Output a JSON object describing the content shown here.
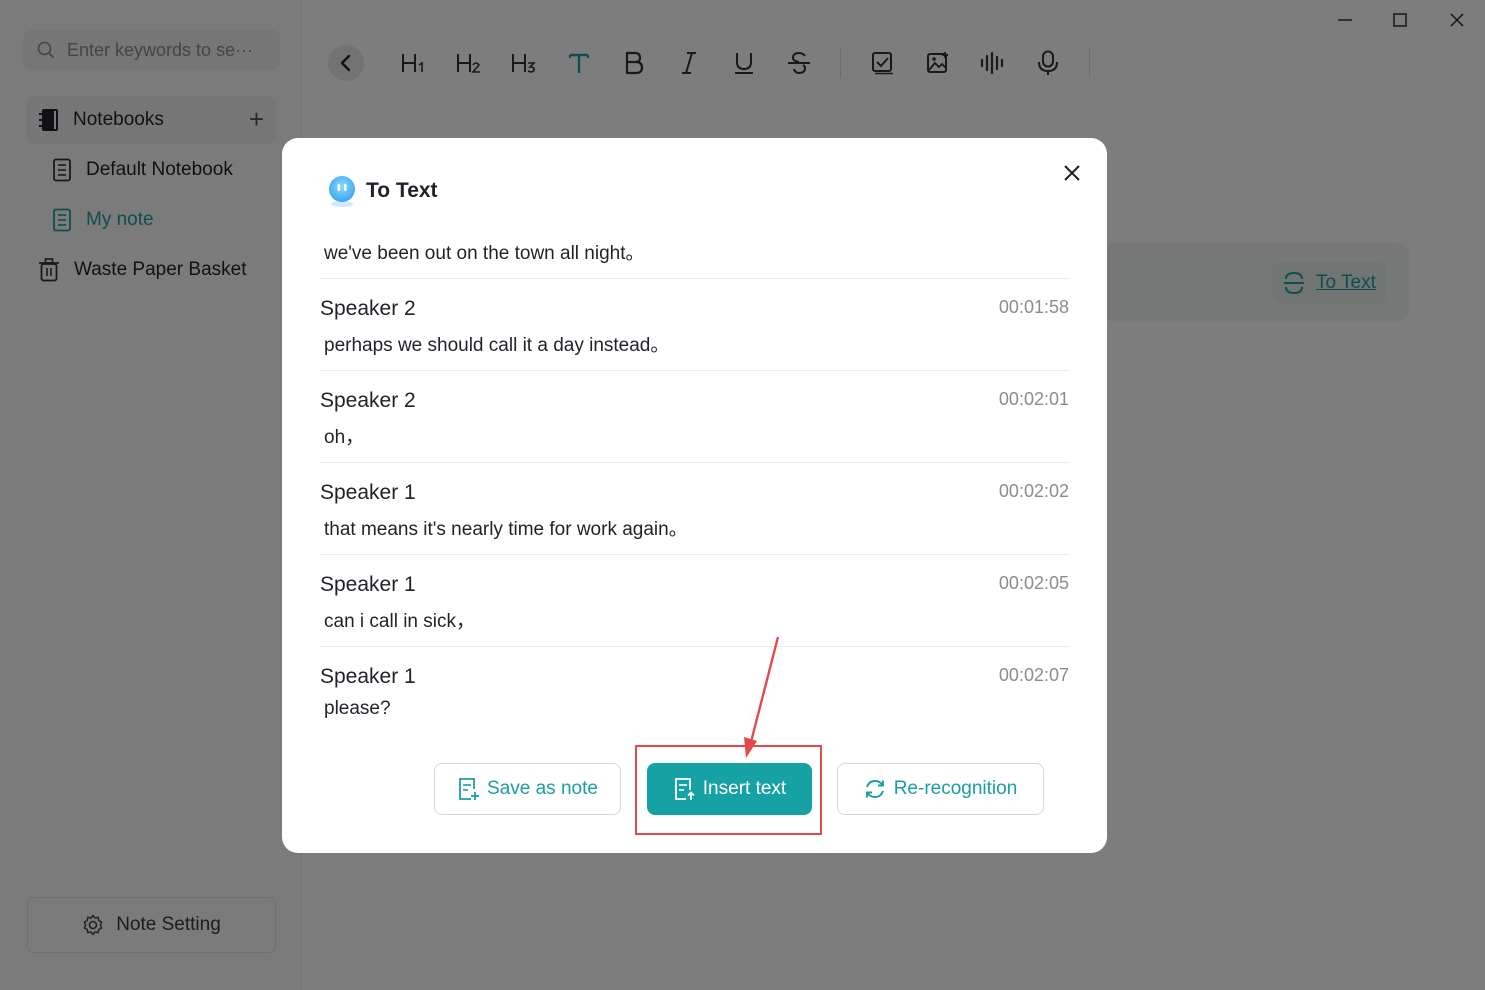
{
  "sidebar": {
    "search_placeholder": "Enter keywords to se···",
    "notebooks_label": "Notebooks",
    "add_symbol": "+",
    "items": [
      {
        "label": "Default Notebook",
        "icon": "notebook-icon"
      },
      {
        "label": "My note",
        "icon": "notebook-icon",
        "active": true
      }
    ],
    "trash_label": "Waste Paper Basket",
    "note_setting_label": "Note Setting"
  },
  "toolbar": {
    "items": [
      "H1",
      "H2",
      "H3",
      "T",
      "B",
      "I",
      "U",
      "S"
    ],
    "icons": [
      "back-icon",
      "heading1-icon",
      "heading2-icon",
      "heading3-icon",
      "text-color-icon",
      "bold-icon",
      "italic-icon",
      "underline-icon",
      "strikethrough-icon",
      "checkbox-icon",
      "image-icon",
      "audio-wave-icon",
      "microphone-icon"
    ]
  },
  "audio_card": {
    "to_text_label": "To Text"
  },
  "modal": {
    "title": "To Text",
    "first_line": "we've been out on the town all night。",
    "entries": [
      {
        "speaker": "Speaker 2",
        "time": "00:01:58",
        "text": "perhaps we should call it a day instead。"
      },
      {
        "speaker": "Speaker 2",
        "time": "00:02:01",
        "text": "oh，"
      },
      {
        "speaker": "Speaker 1",
        "time": "00:02:02",
        "text": "that means it's nearly time for work again。"
      },
      {
        "speaker": "Speaker 1",
        "time": "00:02:05",
        "text": "can i call in sick，"
      },
      {
        "speaker": "Speaker 1",
        "time": "00:02:07",
        "text": "please?"
      }
    ],
    "buttons": {
      "save_as_note": "Save as note",
      "insert_text": "Insert text",
      "re_recognition": "Re-recognition"
    }
  },
  "colors": {
    "accent": "#16a2a4",
    "annotation": "#e5484d"
  }
}
